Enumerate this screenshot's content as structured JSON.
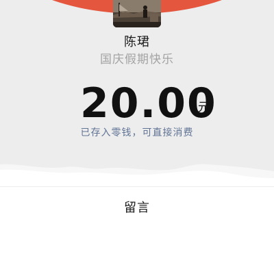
{
  "banner": {
    "color": "#e5563f"
  },
  "sender": {
    "name": "陈珺",
    "greeting": "国庆假期快乐",
    "avatar_icon": "avatar-photo"
  },
  "amount": {
    "value": "20.00",
    "currency": "元"
  },
  "status": {
    "note": "已存入零钱，可直接消费"
  },
  "message": {
    "label": "留言"
  },
  "colors": {
    "background": "#ededed",
    "card": "#ffffff",
    "note_link": "#5f7395",
    "greeting": "#a3a3a3"
  }
}
